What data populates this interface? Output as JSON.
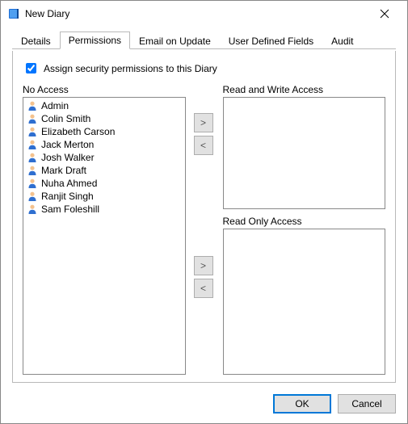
{
  "window": {
    "title": "New Diary"
  },
  "tabs": [
    {
      "label": "Details"
    },
    {
      "label": "Permissions"
    },
    {
      "label": "Email on Update"
    },
    {
      "label": "User Defined Fields"
    },
    {
      "label": "Audit"
    }
  ],
  "activeTabIndex": 1,
  "checkbox": {
    "label": "Assign security permissions to this Diary",
    "checked": true
  },
  "labels": {
    "noAccess": "No Access",
    "readWrite": "Read and Write Access",
    "readOnly": "Read Only Access"
  },
  "lists": {
    "noAccess": [
      "Admin",
      "Colin Smith",
      "Elizabeth Carson",
      "Jack Merton",
      "Josh Walker",
      "Mark Draft",
      "Nuha Ahmed",
      "Ranjit Singh",
      "Sam Foleshill"
    ],
    "readWrite": [],
    "readOnly": []
  },
  "arrows": {
    "right": ">",
    "left": "<"
  },
  "buttons": {
    "ok": "OK",
    "cancel": "Cancel"
  }
}
